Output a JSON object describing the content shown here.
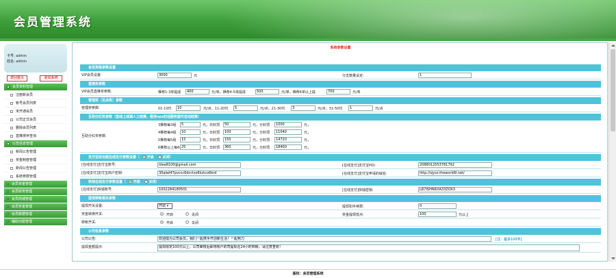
{
  "header": {
    "title": "会员管理系统"
  },
  "user": {
    "card_label": "卡号:",
    "card": "admin",
    "name_label": "姓名:",
    "name": "admin"
  },
  "buttons": {
    "home": "返回首页",
    "logout": "退出系统"
  },
  "menu": {
    "group1": "会员资料管理",
    "group1_items": [
      "注册新会员",
      "帐号会员列表",
      "未开通会员",
      "公司正式会员",
      "删除会员列表",
      "直推排序查询"
    ],
    "group2": "公告信息管理",
    "group2_items": [
      "新闻公告管理",
      "奖金制度管理",
      "新闻公告管理",
      "系统参数管理"
    ],
    "others": [
      "会员资金管理",
      "会员财务管理",
      "会员商城管理",
      "会员奖金管理",
      "会员数据管理",
      "辅助功能管理"
    ]
  },
  "page_title": "系统参数设置",
  "sections": {
    "s1": "会员资格参数设置",
    "s2": "直推奖参数",
    "s3": "管理奖（见点奖）参数",
    "s4": "互助分红奖参数（直线上线满人工结算，租用vps的话服务器可自动结算）",
    "s5": "支付宝双功能在线支付参数设置（",
    "s5_on": "开启",
    "s5_off": "关闭）",
    "s6": "快钱在线支付参数设置（",
    "s6_on": "开启",
    "s6_off": "关闭）",
    "s7": "提现转帐相关参数",
    "s8": "公司信息参数"
  },
  "r1": {
    "label": "VIP会员设置:",
    "value": "3000",
    "unit": "元",
    "label2": "分支数量设定:",
    "value2": "1"
  },
  "r2": {
    "label": "VIP会员直推奖参数:",
    "t1": "推荐1-3单提成",
    "v1": "400",
    "t2": "元/单。推荐4-5单提成",
    "v2": "500",
    "t3": "元/单，推荐6单以上提",
    "v3": "700",
    "t4": "元/单"
  },
  "r3": {
    "label": "管理奖参数:",
    "t1": "01-10代",
    "v1": "10",
    "t2": "元/点，11-20代",
    "v2": "5",
    "t3": "元/点，21-30代",
    "v3": "3",
    "t4": "元/点，31-50代",
    "v4": "1",
    "t5": "元/点"
  },
  "r4": {
    "label": "互助分红奖参数:",
    "lines": [
      [
        "3推荐每3组",
        "5",
        "元，日封顶",
        "50",
        "元，分封顶",
        "1000",
        "元，"
      ],
      [
        "4推荐每4组",
        "10",
        "元，日封顶",
        "100",
        "元，分封顶",
        "11040",
        "元，"
      ],
      [
        "5推荐每5组",
        "15",
        "元，日封顶",
        "150",
        "元，分封顶",
        "14720",
        "元，"
      ],
      [
        "6推荐以上每6组",
        "25",
        "元，日封顶",
        "360",
        "元，分封顶",
        "18400",
        "元，"
      ]
    ]
  },
  "r5": {
    "l1": "[在线支付]支付宝账号:",
    "v1": "idea8100@gmail.com",
    "l2": "[在线支付]支付宝PID:",
    "v2": "2088012553781792"
  },
  "r6": {
    "l1": "[在线支付]支付宝商户密钥:",
    "v1": "30qiwl47pvccc6dcctxz6luhcx6krd",
    "l2": "[在线支付]支付宝申请的域名:",
    "v2": "http://sjysz.theworld9.net/"
  },
  "r7": {
    "l1": "[在线支付]快钱账号:",
    "v1": "1002284180501",
    "l2": "[在线支付]快钱密钥:",
    "v2": "LR7ISHNRXA33ZOX3"
  },
  "r8": {
    "l1": "提现开关设置:",
    "sel": "开启",
    "l2": "提现扣手续费:",
    "v2": "0"
  },
  "r9": {
    "l1": "奖金转换开关:",
    "on": "开启",
    "off": "关闭",
    "l2": "奖金提现低点:",
    "v2": "100",
    "unit": "元以上"
  },
  "r10": {
    "l1": "转帐开关:",
    "on": "开启",
    "off": "关闭"
  },
  "r11": {
    "l1": "公司公告:",
    "v1": "欢迎成为公司会员，我们一起携手开创新生活！一起努力",
    "note": "[注：最多100字]"
  },
  "r12": {
    "l1": "提现金额提示:",
    "v1": "提现限定100元以上，公司审核后即将帐户的司提现在24小时到帐，请注意查收！"
  },
  "footer": "版权：会员管理系统"
}
